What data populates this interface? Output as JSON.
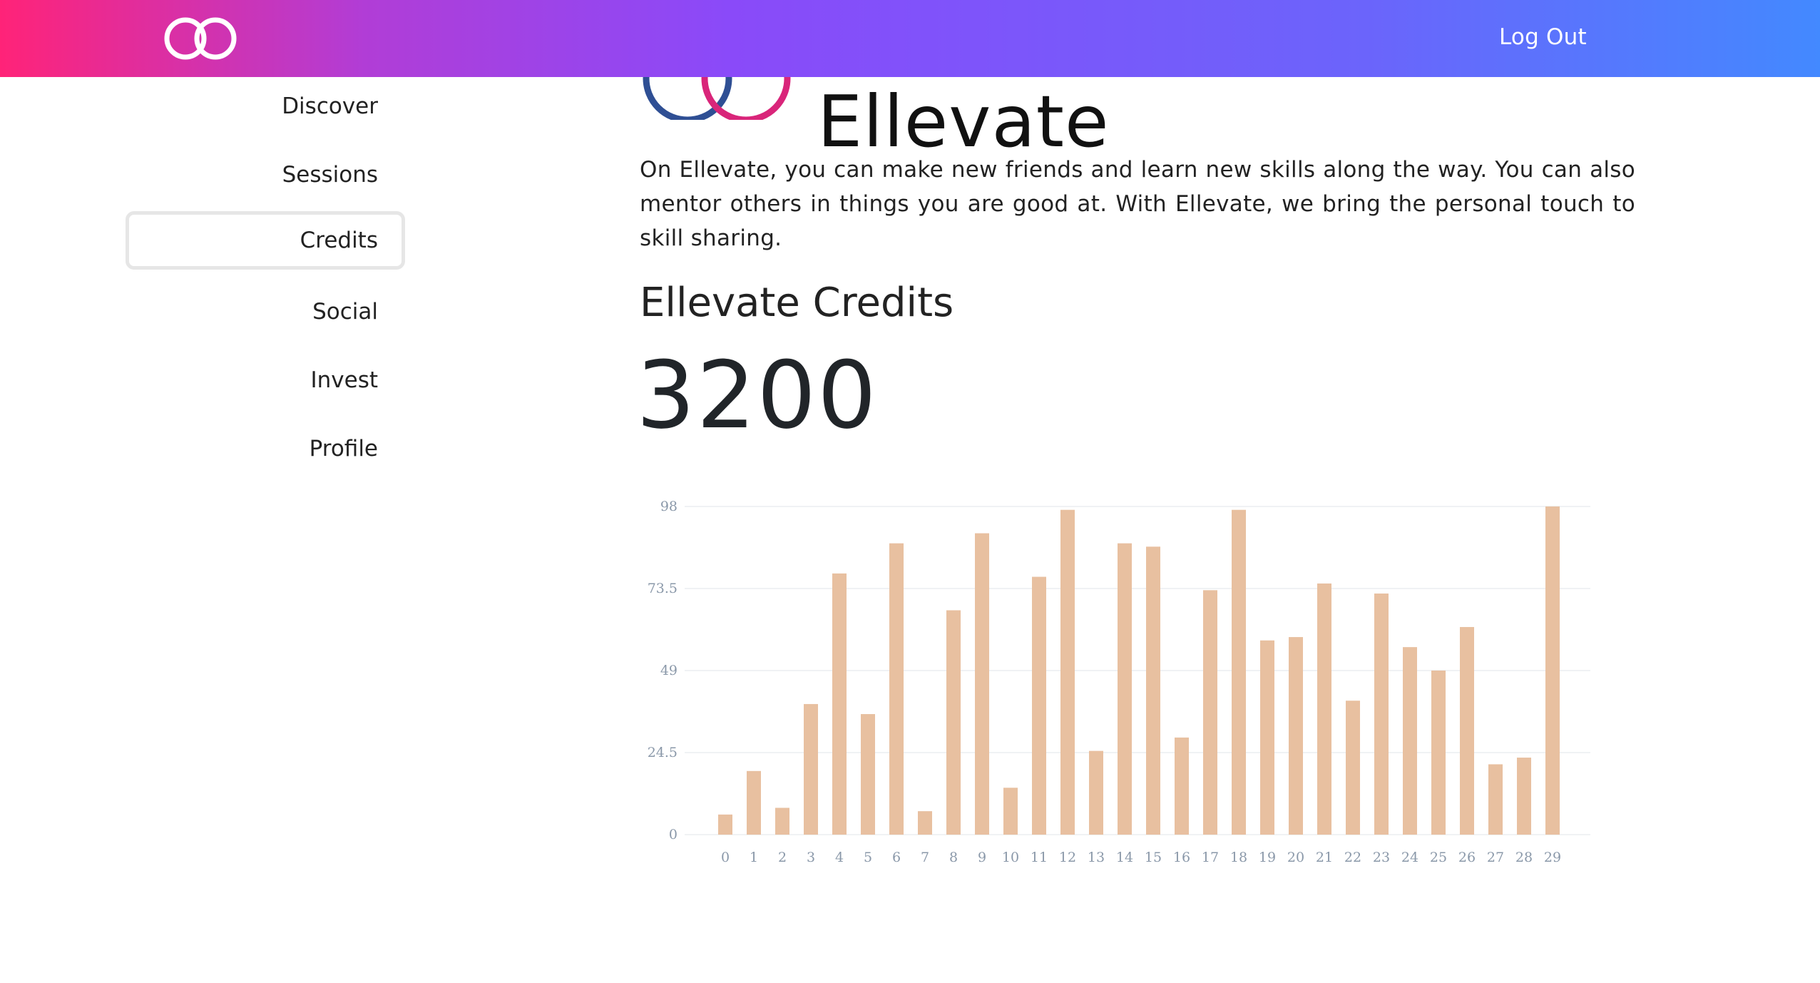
{
  "header": {
    "logout_label": "Log Out"
  },
  "sidebar": {
    "items": [
      {
        "label": "Discover"
      },
      {
        "label": "Sessions"
      },
      {
        "label": "Credits",
        "active": true
      },
      {
        "label": "Social"
      },
      {
        "label": "Invest"
      },
      {
        "label": "Profile"
      }
    ]
  },
  "main": {
    "logo_word": "Ellevate",
    "intro": "On Ellevate, you can make new friends and learn new skills along the way. You can also mentor others in things you are good at. With Ellevate, we bring the personal touch to skill sharing.",
    "credits_title": "Ellevate Credits",
    "credits_value": "3200"
  },
  "colors": {
    "header_gradient": [
      "#ff2378",
      "#8a4af9",
      "#4389ff"
    ],
    "logo_ring_blue": "#2f4f94",
    "logo_ring_pink": "#d9257a",
    "bar": "#e8c0a0"
  },
  "chart_data": {
    "type": "bar",
    "categories": [
      "0",
      "1",
      "2",
      "3",
      "4",
      "5",
      "6",
      "7",
      "8",
      "9",
      "10",
      "11",
      "12",
      "13",
      "14",
      "15",
      "16",
      "17",
      "18",
      "19",
      "20",
      "21",
      "22",
      "23",
      "24",
      "25",
      "26",
      "27",
      "28",
      "29"
    ],
    "values": [
      6,
      19,
      8,
      39,
      78,
      36,
      87,
      7,
      67,
      90,
      14,
      77,
      97,
      25,
      87,
      86,
      29,
      73,
      97,
      58,
      59,
      75,
      40,
      72,
      56,
      49,
      62,
      21,
      23,
      98
    ],
    "yticks": [
      "0",
      "24.5",
      "49",
      "73.5",
      "98"
    ],
    "ylim": [
      0,
      98
    ],
    "grid": true,
    "title": "",
    "xlabel": "",
    "ylabel": ""
  }
}
